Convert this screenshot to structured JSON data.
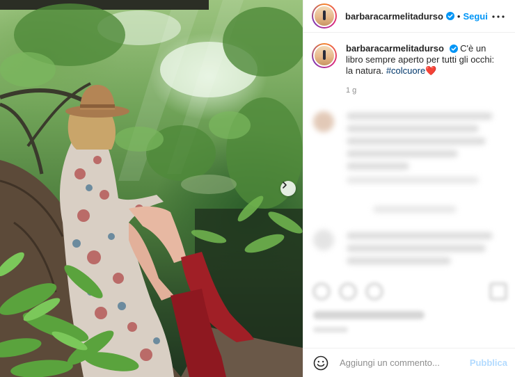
{
  "post": {
    "username": "barbaracarmelitadurso",
    "follow_label": "Segui",
    "separator": "•",
    "caption_text": "C'è un libro sempre aperto per tutti gli occhi: la natura.",
    "hashtag": "#colcuore",
    "heart": "❤️",
    "time_ago": "1 g"
  },
  "composer": {
    "placeholder": "Aggiungi un commento...",
    "publish_label": "Pubblica"
  },
  "icons": {
    "verified": "verified-badge-icon",
    "more": "more-options-icon",
    "next": "chevron-right-icon",
    "emoji": "emoji-icon"
  },
  "colors": {
    "accent": "#0095f6",
    "publish_disabled": "#b3dbff",
    "hashtag": "#00376b",
    "muted": "#8e8e8e"
  }
}
